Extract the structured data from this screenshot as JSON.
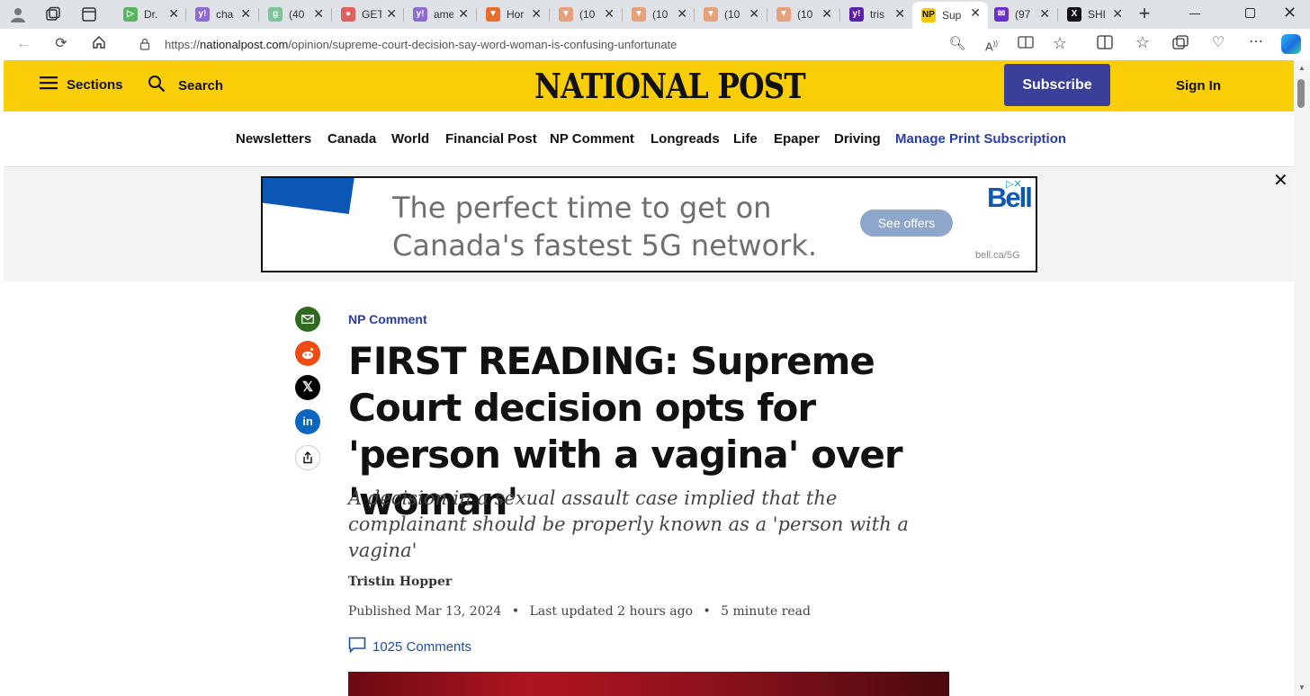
{
  "browser": {
    "tabs": [
      {
        "title": "Dr.",
        "color": "#5bb55e",
        "glyph": "▷"
      },
      {
        "title": "cha",
        "color": "#8e6bd0",
        "glyph": "y!"
      },
      {
        "title": "(40",
        "color": "#7fc59a",
        "glyph": "g"
      },
      {
        "title": "GET",
        "color": "#e06060",
        "glyph": "●"
      },
      {
        "title": "ame",
        "color": "#8e6bd0",
        "glyph": "y!"
      },
      {
        "title": "Hor",
        "color": "#e86d2c",
        "glyph": "▼"
      },
      {
        "title": "(10",
        "color": "#e8a07a",
        "glyph": "▼"
      },
      {
        "title": "(10",
        "color": "#e8a07a",
        "glyph": "▼"
      },
      {
        "title": "(10",
        "color": "#e8a07a",
        "glyph": "▼"
      },
      {
        "title": "(10",
        "color": "#e8a07a",
        "glyph": "▼"
      },
      {
        "title": "tris",
        "color": "#5b1fa8",
        "glyph": "y!"
      },
      {
        "title": "Sup",
        "color": "#f5c80a",
        "glyph": "NP"
      },
      {
        "title": "(97",
        "color": "#6b2fc9",
        "glyph": "✉"
      },
      {
        "title": "SHI",
        "color": "#111111",
        "glyph": "X"
      }
    ],
    "active_tab_index": 11,
    "url_prefix": "https://",
    "url_domain": "nationalpost.com",
    "url_path": "/opinion/supreme-court-decision-say-word-woman-is-confusing-unfortunate"
  },
  "header": {
    "sections_label": "Sections",
    "search_label": "Search",
    "logo_text": "NATIONAL POST",
    "subscribe_label": "Subscribe",
    "signin_label": "Sign In",
    "accent_color": "#f9ce07"
  },
  "nav": {
    "items": [
      "Newsletters",
      "Canada",
      "World",
      "Financial Post",
      "NP Comment",
      "Longreads",
      "Life",
      "Epaper",
      "Driving"
    ],
    "highlight_item": "Manage Print Subscription"
  },
  "ad": {
    "line1": "The perfect time to get on",
    "line2": "Canada's fastest 5G network.",
    "cta": "See offers",
    "brand": "Bell",
    "url": "bell.ca/5G"
  },
  "article": {
    "section": "NP Comment",
    "headline": "FIRST READING: Supreme Court decision opts for 'person with a vagina' over 'woman'",
    "dek": "A decision in a sexual assault case implied that the complainant should be properly known as a 'person with a vagina'",
    "author": "Tristin Hopper",
    "published": "Published Mar 13, 2024",
    "updated": "Last updated 2 hours ago",
    "read_time": "5 minute read",
    "comments": "1025 Comments"
  }
}
